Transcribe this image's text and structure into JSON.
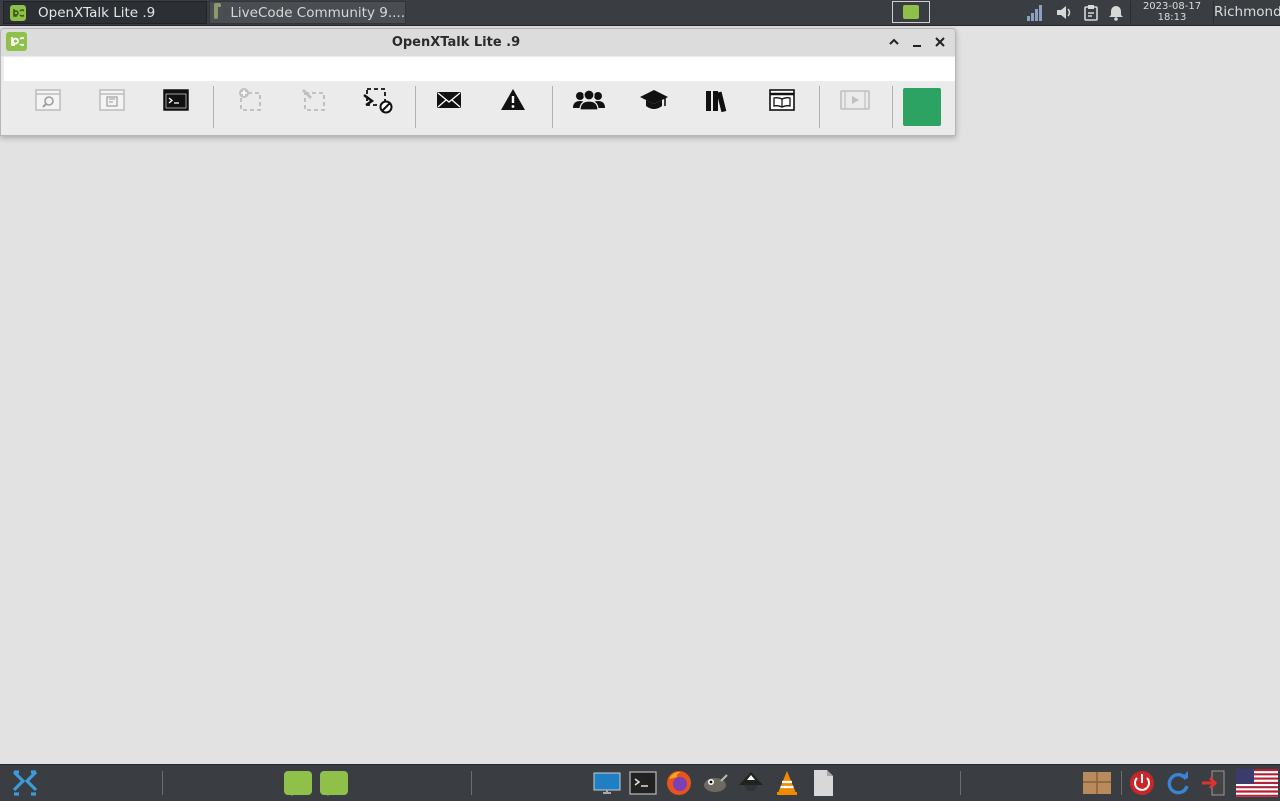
{
  "top_panel": {
    "tasks": [
      {
        "label": "OpenXTalk Lite .9"
      },
      {
        "label": "LiveCode Community 9...."
      }
    ],
    "clock": {
      "date": "2023-08-17",
      "time": "18:13"
    },
    "user": "Richmond"
  },
  "window": {
    "title": "OpenXTalk Lite .9",
    "message_box_value": "",
    "toolbar": [
      {
        "icon": "inspector-icon",
        "enabled": false
      },
      {
        "icon": "stack-browser-icon",
        "enabled": false
      },
      {
        "icon": "terminal-icon",
        "enabled": true
      },
      {
        "icon": "new-group-icon",
        "enabled": false
      },
      {
        "icon": "edit-group-icon",
        "enabled": false
      },
      {
        "icon": "messages-off-icon",
        "enabled": true
      },
      {
        "icon": "mail-icon",
        "enabled": true
      },
      {
        "icon": "warning-icon",
        "enabled": true
      },
      {
        "icon": "community-icon",
        "enabled": true
      },
      {
        "icon": "academy-icon",
        "enabled": true
      },
      {
        "icon": "library-icon",
        "enabled": true
      },
      {
        "icon": "dictionary-icon",
        "enabled": true
      },
      {
        "icon": "run-icon",
        "enabled": false
      }
    ],
    "go_button_color": "#2ca363"
  },
  "bottom_panel": {
    "launchers": [
      "app-menu-icon",
      "livecode-icon",
      "livecode-icon",
      "desktop-icon",
      "terminal-icon",
      "firefox-icon",
      "gimp-icon",
      "inkscape-icon",
      "vlc-icon",
      "file-icon",
      "archive-icon",
      "power-icon",
      "refresh-icon",
      "logout-icon",
      "us-flag-icon"
    ]
  },
  "colors": {
    "panel": "#3a3d42",
    "desktop": "#e2e2e2",
    "accent": "#8fc04a"
  }
}
